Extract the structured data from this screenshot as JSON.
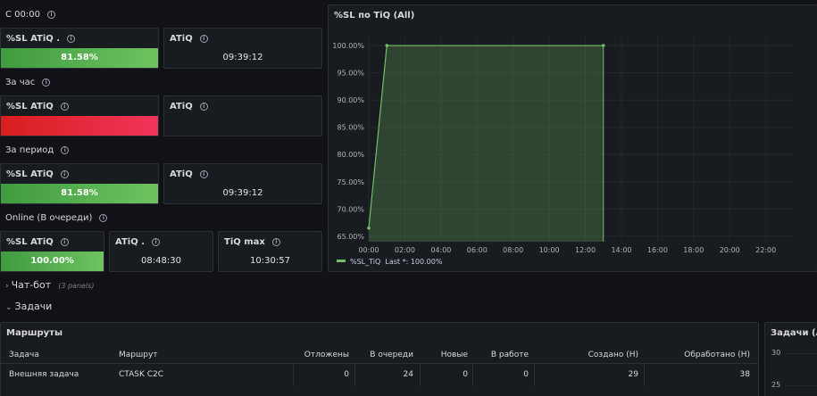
{
  "sections": {
    "since_midnight": "С 00:00",
    "per_hour": "За час",
    "per_period": "За период",
    "online": "Online (В очереди)"
  },
  "stats": {
    "row1": {
      "sl_title": "%SL ATiQ .",
      "sl_value": "81.58%",
      "sl_fill": 0.8158,
      "atiq_title": "ATiQ",
      "atiq_value": "09:39:12"
    },
    "row2": {
      "sl_title": "%SL ATiQ",
      "sl_value": "",
      "atiq_title": "ATiQ",
      "atiq_value": ""
    },
    "row3": {
      "sl_title": "%SL ATiQ",
      "sl_value": "81.58%",
      "sl_fill": 0.8158,
      "atiq_title": "ATiQ",
      "atiq_value": "09:39:12"
    },
    "row4": {
      "sl_title": "%SL ATiQ",
      "sl_value": "100.00%",
      "sl_fill": 1.0,
      "atiq_title": "ATiQ .",
      "atiq_value": "08:48:30",
      "tiqmax_title": "TiQ max",
      "tiqmax_value": "10:30:57"
    }
  },
  "colors": {
    "good": "#73bf69",
    "bad": "#f2495c",
    "panel_bg": "#181b1f",
    "border": "#2c2f36"
  },
  "chart_data": {
    "type": "area",
    "title": "%SL по TiQ (All)",
    "x_ticks": [
      "00:00",
      "02:00",
      "04:00",
      "06:00",
      "08:00",
      "10:00",
      "12:00",
      "14:00",
      "16:00",
      "18:00",
      "20:00",
      "22:00"
    ],
    "y_ticks": [
      "100.00%",
      "95.00%",
      "90.00%",
      "85.00%",
      "80.00%",
      "75.00%",
      "70.00%",
      "65.00%"
    ],
    "ylim": [
      64,
      100.5
    ],
    "xlim_hours": [
      0,
      23.5
    ],
    "grid": true,
    "legend_placement": "bottom-left",
    "series": [
      {
        "name": "%SL_TiQ",
        "color": "#73bf69",
        "x": [
          "00:00",
          "01:00",
          "13:00"
        ],
        "x_hours": [
          0,
          1,
          13
        ],
        "y": [
          66.5,
          100,
          100
        ]
      }
    ],
    "legend_name": "%SL_TiQ",
    "legend_last": "Last *: 100.00%"
  },
  "rows": {
    "chatbot": {
      "label": "Чат-бот",
      "count": "(3 panels)"
    },
    "tasks": {
      "label": "Задачи"
    }
  },
  "routes_table": {
    "title": "Маршруты",
    "headers": [
      "Задача",
      "Маршрут",
      "Отложены",
      "В очереди",
      "Новые",
      "В работе",
      "Создано (Н)",
      "Обработано (Н)"
    ],
    "row": [
      "Внешняя задача",
      "CTASK C2C",
      "0",
      "24",
      "0",
      "0",
      "29",
      "38"
    ]
  },
  "tasks_panel": {
    "title": "Задачи (All",
    "y_ticks": [
      "30",
      "25"
    ]
  }
}
